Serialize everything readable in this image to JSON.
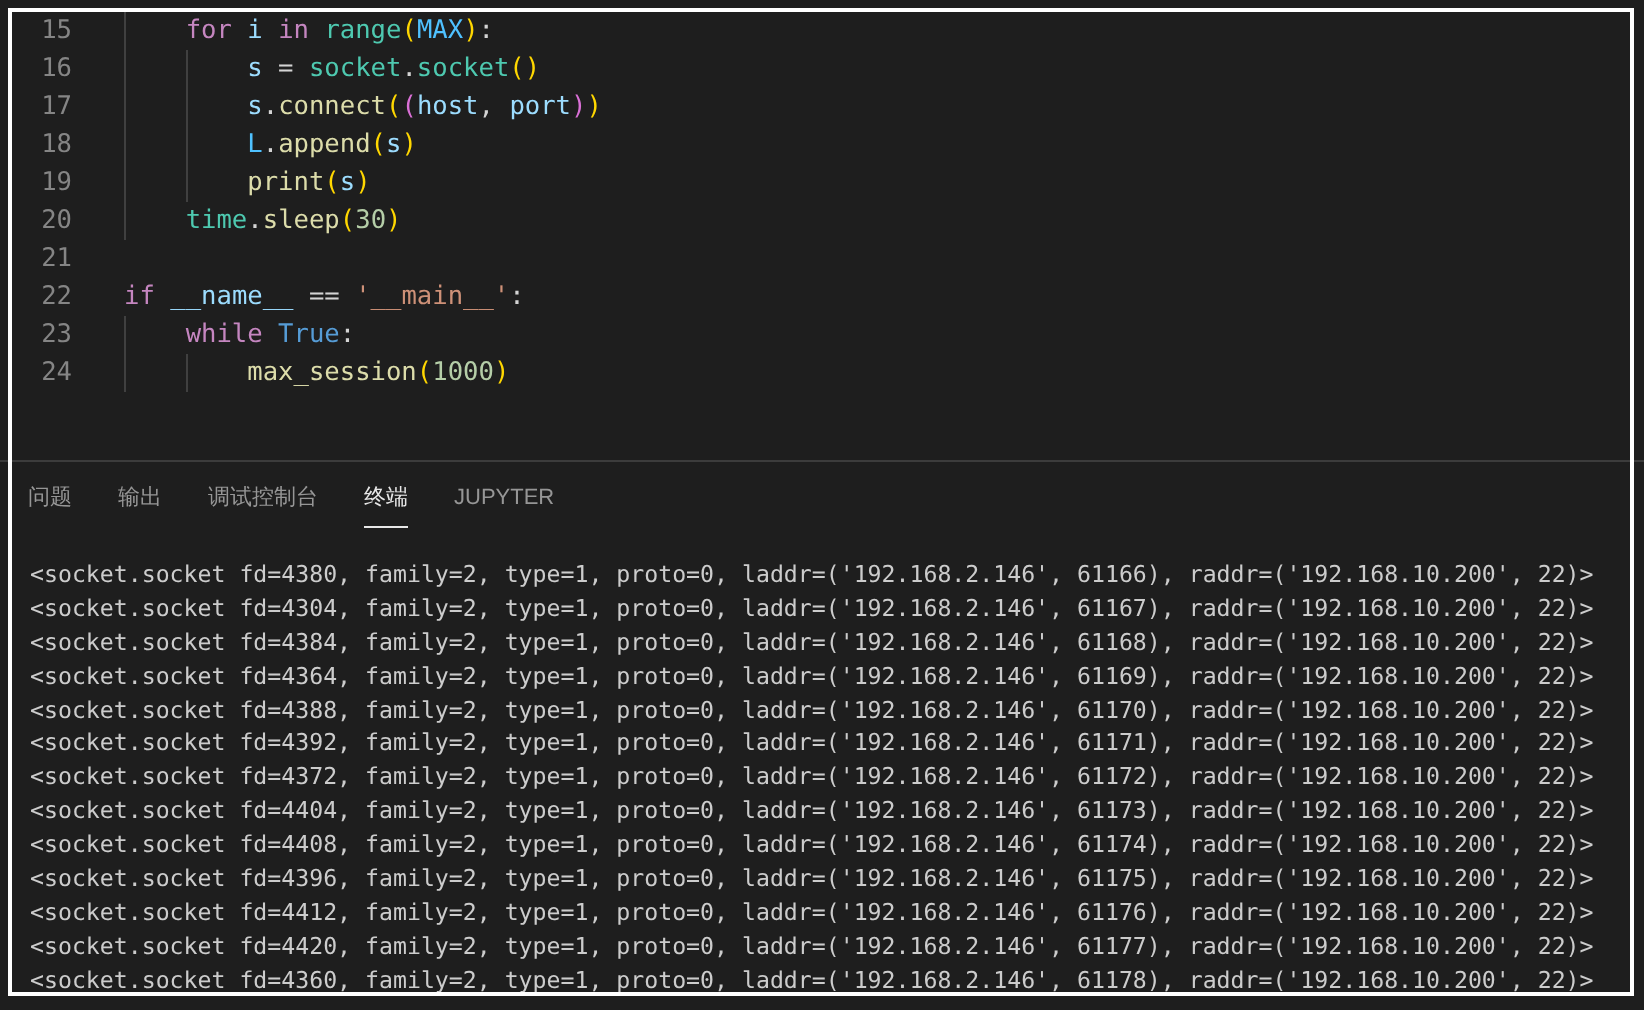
{
  "editor": {
    "lines": [
      {
        "number": "15",
        "tokens": [
          {
            "text": "    for",
            "kind": "keyword"
          },
          {
            "text": " i ",
            "kind": "variable"
          },
          {
            "text": "in",
            "kind": "keyword"
          },
          {
            "text": " range",
            "kind": "type"
          },
          {
            "text": "(",
            "kind": "bracket1"
          },
          {
            "text": "MAX",
            "kind": "constant"
          },
          {
            "text": ")",
            "kind": "bracket1"
          },
          {
            "text": ":",
            "kind": "plain"
          }
        ]
      },
      {
        "number": "16",
        "tokens": [
          {
            "text": "        s",
            "kind": "variable"
          },
          {
            "text": " = ",
            "kind": "plain"
          },
          {
            "text": "socket",
            "kind": "type"
          },
          {
            "text": ".",
            "kind": "plain"
          },
          {
            "text": "socket",
            "kind": "type"
          },
          {
            "text": "()",
            "kind": "bracket1"
          }
        ]
      },
      {
        "number": "17",
        "tokens": [
          {
            "text": "        s",
            "kind": "variable"
          },
          {
            "text": ".",
            "kind": "plain"
          },
          {
            "text": "connect",
            "kind": "function"
          },
          {
            "text": "(",
            "kind": "bracket1"
          },
          {
            "text": "(",
            "kind": "bracket2"
          },
          {
            "text": "host",
            "kind": "variable"
          },
          {
            "text": ", ",
            "kind": "plain"
          },
          {
            "text": "port",
            "kind": "variable"
          },
          {
            "text": ")",
            "kind": "bracket2"
          },
          {
            "text": ")",
            "kind": "bracket1"
          }
        ]
      },
      {
        "number": "18",
        "tokens": [
          {
            "text": "        L",
            "kind": "constant"
          },
          {
            "text": ".",
            "kind": "plain"
          },
          {
            "text": "append",
            "kind": "function"
          },
          {
            "text": "(",
            "kind": "bracket1"
          },
          {
            "text": "s",
            "kind": "variable"
          },
          {
            "text": ")",
            "kind": "bracket1"
          }
        ]
      },
      {
        "number": "19",
        "tokens": [
          {
            "text": "        print",
            "kind": "function"
          },
          {
            "text": "(",
            "kind": "bracket1"
          },
          {
            "text": "s",
            "kind": "variable"
          },
          {
            "text": ")",
            "kind": "bracket1"
          }
        ]
      },
      {
        "number": "20",
        "tokens": [
          {
            "text": "    time",
            "kind": "type"
          },
          {
            "text": ".",
            "kind": "plain"
          },
          {
            "text": "sleep",
            "kind": "function"
          },
          {
            "text": "(",
            "kind": "bracket1"
          },
          {
            "text": "30",
            "kind": "number"
          },
          {
            "text": ")",
            "kind": "bracket1"
          }
        ]
      },
      {
        "number": "21"
      },
      {
        "number": "22",
        "tokens": [
          {
            "text": "if",
            "kind": "keyword"
          },
          {
            "text": " __name__",
            "kind": "variable"
          },
          {
            "text": " == ",
            "kind": "plain"
          },
          {
            "text": "'__main__'",
            "kind": "string"
          },
          {
            "text": ":",
            "kind": "plain"
          }
        ]
      },
      {
        "number": "23",
        "tokens": [
          {
            "text": "    while",
            "kind": "keyword"
          },
          {
            "text": " True",
            "kind": "boolean"
          },
          {
            "text": ":",
            "kind": "plain"
          }
        ]
      },
      {
        "number": "24",
        "tokens": [
          {
            "text": "        max_session",
            "kind": "function"
          },
          {
            "text": "(",
            "kind": "bracket1"
          },
          {
            "text": "1000",
            "kind": "number"
          },
          {
            "text": ")",
            "kind": "bracket1"
          }
        ]
      }
    ]
  },
  "panel": {
    "tabs": [
      {
        "label": "问题",
        "selected": false
      },
      {
        "label": "输出",
        "selected": false
      },
      {
        "label": "调试控制台",
        "selected": false
      },
      {
        "label": "终端",
        "selected": true
      },
      {
        "label": "JUPYTER",
        "selected": false
      }
    ],
    "terminal_lines": [
      "<socket.socket fd=4380, family=2, type=1, proto=0, laddr=('192.168.2.146', 61166), raddr=('192.168.10.200', 22)>",
      "<socket.socket fd=4304, family=2, type=1, proto=0, laddr=('192.168.2.146', 61167), raddr=('192.168.10.200', 22)>",
      "<socket.socket fd=4384, family=2, type=1, proto=0, laddr=('192.168.2.146', 61168), raddr=('192.168.10.200', 22)>",
      "<socket.socket fd=4364, family=2, type=1, proto=0, laddr=('192.168.2.146', 61169), raddr=('192.168.10.200', 22)>",
      "<socket.socket fd=4388, family=2, type=1, proto=0, laddr=('192.168.2.146', 61170), raddr=('192.168.10.200', 22)>",
      "<socket.socket fd=4392, family=2, type=1, proto=0, laddr=('192.168.2.146', 61171), raddr=('192.168.10.200', 22)>",
      "<socket.socket fd=4372, family=2, type=1, proto=0, laddr=('192.168.2.146', 61172), raddr=('192.168.10.200', 22)>",
      "<socket.socket fd=4404, family=2, type=1, proto=0, laddr=('192.168.2.146', 61173), raddr=('192.168.10.200', 22)>",
      "<socket.socket fd=4408, family=2, type=1, proto=0, laddr=('192.168.2.146', 61174), raddr=('192.168.10.200', 22)>",
      "<socket.socket fd=4396, family=2, type=1, proto=0, laddr=('192.168.2.146', 61175), raddr=('192.168.10.200', 22)>",
      "<socket.socket fd=4412, family=2, type=1, proto=0, laddr=('192.168.2.146', 61176), raddr=('192.168.10.200', 22)>",
      "<socket.socket fd=4420, family=2, type=1, proto=0, laddr=('192.168.2.146', 61177), raddr=('192.168.10.200', 22)>",
      "<socket.socket fd=4360, family=2, type=1, proto=0, laddr=('192.168.2.146', 61178), raddr=('192.168.10.200', 22)>"
    ]
  }
}
